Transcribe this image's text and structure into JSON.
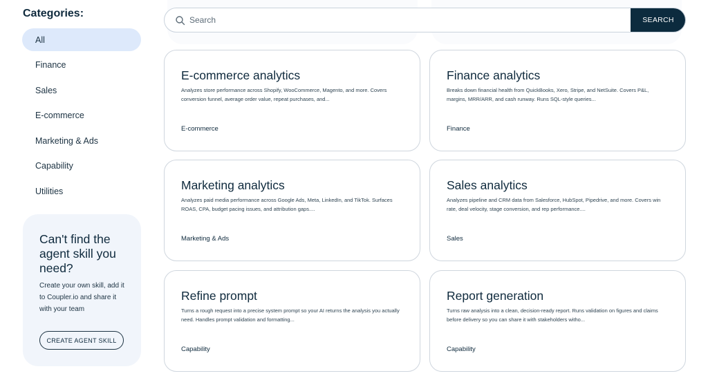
{
  "sidebar": {
    "heading": "Categories:",
    "categories": [
      "All",
      "Finance",
      "Sales",
      "E-commerce",
      "Marketing & Ads",
      "Capability",
      "Utilities"
    ],
    "active_index": 0,
    "promo": {
      "title": "Can't find the agent skill you need?",
      "text": "Create your own skill, add it to Coupler.io and share it with your team",
      "button_label": "CREATE AGENT SKILL"
    }
  },
  "search": {
    "placeholder": "Search",
    "value": "",
    "button_label": "SEARCH"
  },
  "cards": [
    {
      "title": "E-commerce analytics",
      "description": "Analyzes store performance across Shopify, WooCommerce, Magento, and more. Covers conversion funnel, average order value, repeat purchases, and...",
      "tag": "E-commerce"
    },
    {
      "title": "Finance analytics",
      "description": "Breaks down financial health from QuickBooks, Xero, Stripe, and NetSuite. Covers P&L, margins, MRR/ARR, and cash runway. Runs SQL-style queries...",
      "tag": "Finance"
    },
    {
      "title": "Marketing analytics",
      "description": "Analyzes paid media performance across Google Ads, Meta, LinkedIn, and TikTok. Surfaces ROAS, CPA, budget pacing issues, and attribution gaps....",
      "tag": "Marketing & Ads"
    },
    {
      "title": "Sales analytics",
      "description": "Analyzes pipeline and CRM data from Salesforce, HubSpot, Pipedrive, and more. Covers win rate, deal velocity, stage conversion, and rep performance....",
      "tag": "Sales"
    },
    {
      "title": "Refine prompt",
      "description": "Turns a rough request into a precise system prompt so your AI returns the analysis you actually need. Handles prompt validation and formatting...",
      "tag": "Capability"
    },
    {
      "title": "Report generation",
      "description": "Turns raw analysis into a clean, decision-ready report. Runs validation on figures and claims before delivery so you can share it with stakeholders witho...",
      "tag": "Capability"
    }
  ]
}
